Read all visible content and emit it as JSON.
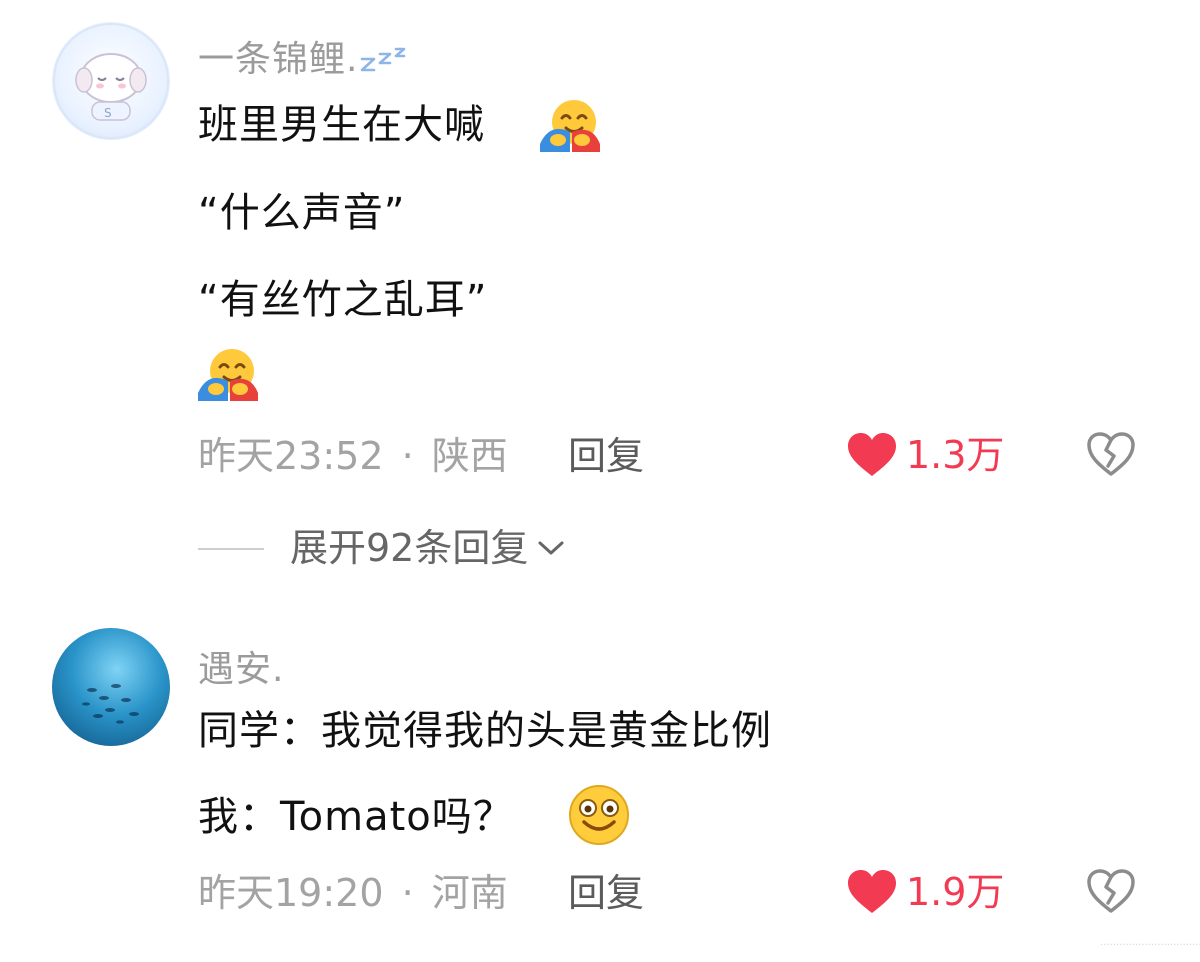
{
  "comments": [
    {
      "username": "一条锦鲤.",
      "username_suffix": "z z z",
      "lines": [
        "班里男生在大喊",
        "“什么声音”",
        "“有丝竹之乱耳”"
      ],
      "emoji": "hugging-face",
      "time": "昨天23:52",
      "sep": "·",
      "location": "陕西",
      "reply_label": "回复",
      "likes": "1.3万"
    },
    {
      "username": "遇安.",
      "lines": [
        "同学：我觉得我的头是黄金比例",
        "我：Tomato吗？"
      ],
      "emoji": "smiley-face",
      "time": "昨天19:20",
      "sep": "·",
      "location": "河南",
      "reply_label": "回复",
      "likes": "1.9万"
    }
  ],
  "expand_replies": {
    "label": "展开92条回复"
  },
  "watermark": "·········································",
  "colors": {
    "like": "#f23a53",
    "meta": "#a3a3a3",
    "username": "#9b9b9b"
  }
}
